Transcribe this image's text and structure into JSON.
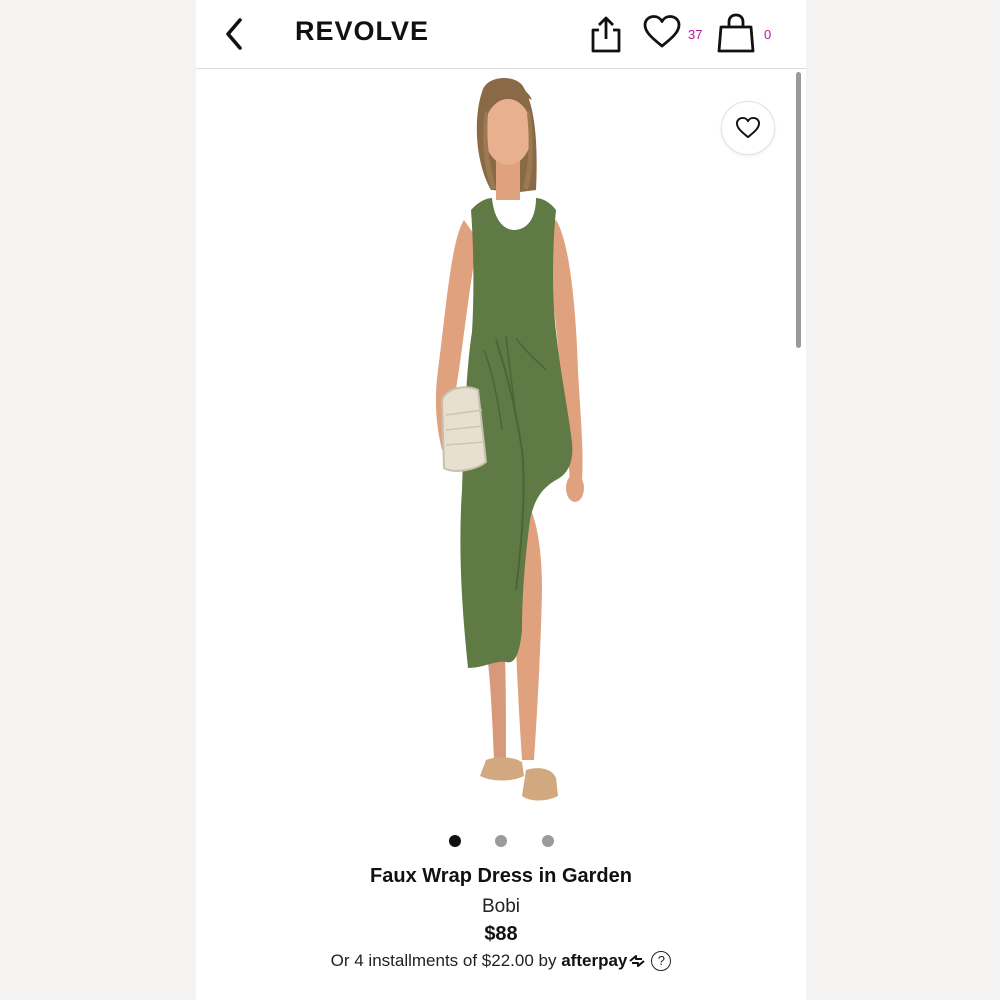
{
  "app": {
    "logo": "REVOLVE",
    "wishlist_count": "37",
    "bag_count": "0"
  },
  "icons": {
    "back": "chevron-left-icon",
    "share": "share-icon",
    "wishlist": "heart-icon",
    "bag": "shopping-bag-icon",
    "favorite": "heart-icon"
  },
  "colors": {
    "count_accent": "#b5179e",
    "dress": "#5f7a44"
  },
  "gallery": {
    "total_images": 3,
    "active_index": 0
  },
  "product": {
    "name": "Faux Wrap Dress in Garden",
    "brand": "Bobi",
    "price": "$88",
    "installments_text": "Or 4 installments of $22.00 by",
    "afterpay_label": "afterpay",
    "help_symbol": "?"
  }
}
